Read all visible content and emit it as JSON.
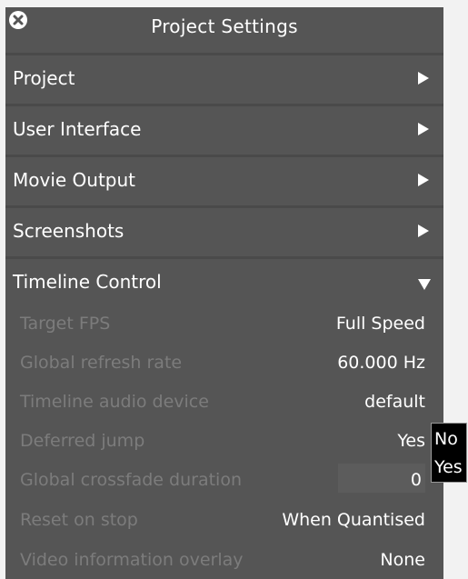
{
  "window": {
    "title": "Project Settings",
    "close_icon": "close-circle-icon"
  },
  "sections": [
    {
      "label": "Project",
      "state": "collapsed",
      "icon": "triangle-right-icon"
    },
    {
      "label": "User Interface",
      "state": "collapsed",
      "icon": "triangle-right-icon"
    },
    {
      "label": "Movie Output",
      "state": "collapsed",
      "icon": "triangle-right-icon"
    },
    {
      "label": "Screenshots",
      "state": "collapsed",
      "icon": "triangle-right-icon"
    },
    {
      "label": "Timeline Control",
      "state": "expanded",
      "icon": "triangle-down-icon"
    }
  ],
  "timeline_control": {
    "rows": [
      {
        "label": "Target FPS",
        "value": "Full Speed"
      },
      {
        "label": "Global refresh rate",
        "value": "60.000 Hz"
      },
      {
        "label": "Timeline audio device",
        "value": "default"
      },
      {
        "label": "Deferred jump",
        "value": "Yes"
      },
      {
        "label": "Global crossfade duration",
        "value": "0"
      },
      {
        "label": "Reset on stop",
        "value": "When Quantised"
      },
      {
        "label": "Video information overlay",
        "value": "None"
      }
    ]
  },
  "dropdown": {
    "options": [
      "No",
      "Yes"
    ]
  },
  "colors": {
    "panel_bg": "#555555",
    "divider": "#4a4a4a",
    "label_muted": "#7c7c7c",
    "text": "#ffffff",
    "page_bg": "#f2f2f2",
    "popup_bg": "#000000"
  }
}
